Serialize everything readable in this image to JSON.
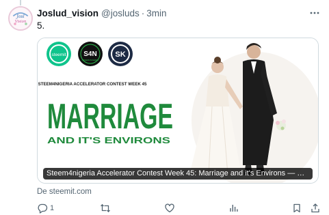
{
  "tweet": {
    "display_name": "Joslud_vision",
    "handle": "@josluds",
    "separator": "·",
    "time": "3min",
    "text": "5."
  },
  "card": {
    "logo_left_text": "steemit",
    "logo_middle_text": "S4N",
    "logo_middle_subtext": "STEEM4NIGERIA",
    "logo_right_text": "SK",
    "contest_line": "STEEM4NIGERIA ACCELERATOR CONTEST WEEK 45",
    "headline": "MARRIAGE",
    "subheadline": "AND IT'S ENVIRONS",
    "title": "Steem4nigeria Accelerator Contest Week 45: Marriage and it's Environs — Steemit",
    "domain": "De steemit.com"
  },
  "actions": {
    "reply_count": "1",
    "repost_count": "",
    "like_count": "",
    "views_count": ""
  },
  "colors": {
    "headline_green": "#1f8a3c",
    "text_primary": "#0f1419",
    "text_secondary": "#536471",
    "border": "#cfd9de"
  },
  "icons": {
    "more": "more-icon",
    "reply": "reply-icon",
    "repost": "repost-icon",
    "like": "like-icon",
    "views": "views-icon",
    "bookmark": "bookmark-icon",
    "share": "share-icon"
  }
}
